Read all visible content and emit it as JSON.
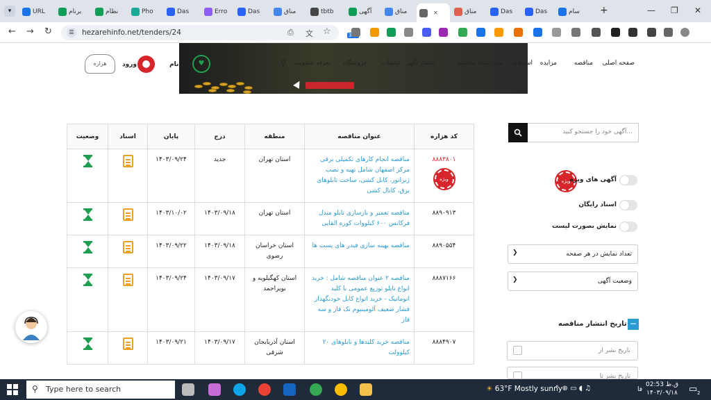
{
  "browser": {
    "tabs": [
      {
        "label": "URL",
        "color": "#1a73e8"
      },
      {
        "label": "برنام",
        "color": "#0f9d58"
      },
      {
        "label": "نظام",
        "color": "#0f9d58"
      },
      {
        "label": "Pho",
        "color": "#18a999"
      },
      {
        "label": "Das",
        "color": "#2962ff"
      },
      {
        "label": "Erro",
        "color": "#8e5cf7"
      },
      {
        "label": "Das",
        "color": "#2962ff"
      },
      {
        "label": "مناق",
        "color": "#4285f4"
      },
      {
        "label": "tbtb",
        "color": "#444444"
      },
      {
        "label": "آگهی",
        "color": "#0f9d58"
      },
      {
        "label": "مناق",
        "color": "#4285f4"
      },
      {
        "label": "",
        "color": "#666666"
      },
      {
        "label": "مناق",
        "color": "#e06050"
      },
      {
        "label": "Das",
        "color": "#2962ff"
      },
      {
        "label": "Das",
        "color": "#2962ff"
      },
      {
        "label": "سام",
        "color": "#1a73e8"
      }
    ],
    "new_tab": "+",
    "url": "hezarehinfo.net/tenders/24",
    "ext_badge": "341"
  },
  "site": {
    "menu": [
      "صفحه اصلی",
      "مناقصه",
      "مزایده",
      "استعلام",
      "تهیه اسناد مناقصه",
      "انتشار آگهی",
      "تبلیغات",
      "فروشگاه",
      "تعرفه عضویت"
    ],
    "register": "ثبت نام",
    "login": "ورود",
    "logo_text": "هزاره"
  },
  "table": {
    "headers": [
      "کد هزاره",
      "عنوان مناقصه",
      "منطقه",
      "درج",
      "پایان",
      "اسناد",
      "وضعیت"
    ],
    "rows": [
      {
        "code": "۸۸۸۳۸۰۱",
        "title": "مناقصه انجام کارهای تکمیلی برقی مرکز اصفهان شامل تهیه و نصب ژنراتور، کابل کشی، ساخت تابلوهای برق، کانال کشی",
        "region": "استان تهران",
        "insert": "جدید",
        "end": "۱۴۰۳/۰۹/۲۴",
        "special": true,
        "stamp": "ویژه"
      },
      {
        "code": "۸۸۹۰۹۱۳",
        "title": "مناقصه تعمیر و بازسازی تابلو مبدل فرکانس ۶۰۰ کیلووات کوره القایی",
        "region": "استان تهران",
        "insert": "۱۴۰۳/۰۹/۱۸",
        "end": "۱۴۰۳/۱۰/۰۲"
      },
      {
        "code": "۸۸۹۰۵۵۴",
        "title": "مناقصه بهینه سازی فیدر های پست ها",
        "region": "استان خراسان رضوی",
        "insert": "۱۴۰۳/۰۹/۱۸",
        "end": "۱۴۰۳/۰۹/۲۲"
      },
      {
        "code": "۸۸۸۷۱۶۶",
        "title": "مناقصه ۲ عنوان مناقصه شامل : خرید انواع تابلو توزیع عمومی با کلید اتوماتیک - خرید انواع کابل خودنگهدار فشار ضعیف آلومینیوم تک فاز و سه فاز",
        "region": "استان کهگیلویه و بویراحمد",
        "insert": "۱۴۰۳/۰۹/۱۷",
        "end": "۱۴۰۳/۰۹/۲۴"
      },
      {
        "code": "۸۸۸۴۹۰۷",
        "title": "مناقصه خرید کلیدها و تابلوهای ۲۰ کیلوولت",
        "region": "استان آذربایجان شرقی",
        "insert": "۱۴۰۳/۰۹/۱۷",
        "end": "۱۴۰۳/۰۹/۲۱"
      }
    ]
  },
  "sidebar": {
    "search_placeholder": "آگهی خود را جستجو کنید...",
    "toggles": [
      "آگهی های ویژه",
      "اسناد رایگان",
      "نمایش بصورت لیست"
    ],
    "special_stamp": "ویژه",
    "per_page": "تعداد نمایش در هر صفحه",
    "status": "وضعیت آگهی",
    "date_section": "تاریخ انتشار مناقصه",
    "date_from": "تاریخ نشر از",
    "date_to": "تاریخ نشر تا"
  },
  "taskbar": {
    "search": "Type here to search",
    "weather_temp": "63°F",
    "weather_text": "Mostly sunny",
    "time": "02:53 ق.ظ",
    "date": "۱۴۰۳/۰۹/۱۸",
    "lang": "فا",
    "notif": "2"
  },
  "colors": {
    "accent": "#2a9bd4",
    "hourglass": "#1f9e52",
    "doc": "#f0a020",
    "stamp": "#d6262b"
  }
}
